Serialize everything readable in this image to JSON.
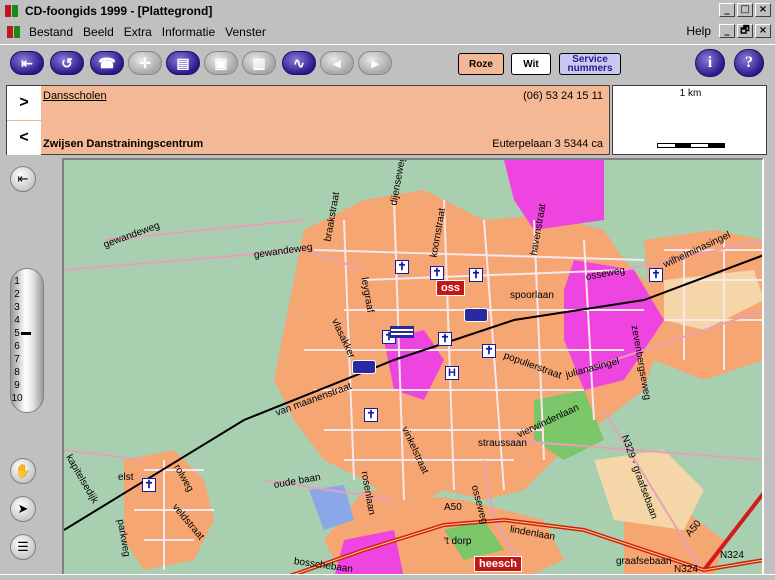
{
  "window": {
    "title": "CD-foongids 1999 - [Plattegrond]",
    "minimize": "_",
    "maximize": "□",
    "close": "×",
    "restore": "🗗"
  },
  "menu": {
    "items": [
      "Bestand",
      "Beeld",
      "Extra",
      "Informatie",
      "Venster"
    ],
    "help": "Help"
  },
  "toolbar": {
    "buttons": [
      "back-arrow-icon",
      "undo-icon",
      "phone-icon",
      "crosshair-icon",
      "print-icon",
      "save-icon",
      "book-icon",
      "route-icon",
      "flag-left-icon",
      "flag-right-icon"
    ],
    "mode_roze": "Roze",
    "mode_wit": "Wit",
    "mode_service_1": "Service",
    "mode_service_2": "nummers",
    "info": "i",
    "help": "?"
  },
  "colors": {
    "roze": "#f4b894",
    "accent": "#2a1a8a",
    "urban": "#f5a673",
    "industrial": "#ee44e0",
    "green": "#a8cfb0",
    "rail": "#000000",
    "highway": "#d21c1c"
  },
  "info": {
    "next": ">",
    "prev": "<",
    "category": "Dansscholen",
    "phone": "(06) 53 24 15 11",
    "name": "Zwijsen Danstrainingscentrum",
    "address": "Euterpelaan 3 5344 ca"
  },
  "scale": {
    "label": "1 km"
  },
  "zoom": {
    "levels": [
      "1",
      "2",
      "3",
      "4",
      "5",
      "6",
      "7",
      "8",
      "9",
      "10"
    ],
    "current": 5
  },
  "sidebar": {
    "home": "home-icon",
    "hand": "hand-icon",
    "pointer": "pointer-icon",
    "list": "list-icon"
  },
  "map": {
    "cities": [
      "oss",
      "heesch"
    ],
    "streets": [
      "gewandeweg",
      "gewandeweg",
      "braakstraat",
      "dijenseweg",
      "leygraaf",
      "koornstraat",
      "havenstraat",
      "spoorlaan",
      "osseweg",
      "wilhelminasingel",
      "vlasakker",
      "populierstraat",
      "julianasingel",
      "zevenbergseweg",
      "van maanenstraat",
      "vinkelstraat",
      "kapitelsedijk",
      "elst",
      "rolweg",
      "oude baan",
      "straussaan",
      "vierwindenlaan",
      "N329 - graafsebaan",
      "A50",
      "lindenlaan",
      "veldstraat",
      "osseweg",
      "rosenlaan",
      "bosschebaan",
      "'t dorp",
      "parkweg",
      "graafsebaan",
      "A50",
      "N324",
      "N324"
    ]
  }
}
